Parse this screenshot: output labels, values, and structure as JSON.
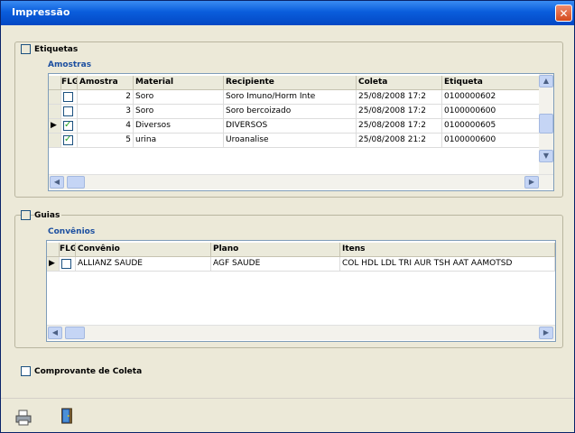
{
  "window": {
    "title": "Impressão",
    "close_label": "✕"
  },
  "etiquetas": {
    "label": "Etiquetas",
    "checked": false,
    "sublabel": "Amostras",
    "columns": [
      "FLG",
      "Amostra",
      "Material",
      "Recipiente",
      "Coleta",
      "Etiqueta"
    ],
    "rows": [
      {
        "current": false,
        "flg": false,
        "amostra": "2",
        "material": "Soro",
        "recipiente": "Soro Imuno/Horm Inte",
        "coleta": "25/08/2008 17:2",
        "etiqueta": "0100000602"
      },
      {
        "current": false,
        "flg": false,
        "amostra": "3",
        "material": "Soro",
        "recipiente": "Soro bercoizado",
        "coleta": "25/08/2008 17:2",
        "etiqueta": "0100000600"
      },
      {
        "current": true,
        "flg": true,
        "amostra": "4",
        "material": "Diversos",
        "recipiente": "DIVERSOS",
        "coleta": "25/08/2008 17:2",
        "etiqueta": "0100000605"
      },
      {
        "current": false,
        "flg": true,
        "amostra": "5",
        "material": "urina",
        "recipiente": "Uroanalise",
        "coleta": "25/08/2008 21:2",
        "etiqueta": "0100000600"
      }
    ]
  },
  "guias": {
    "label": "Guias",
    "checked": false,
    "sublabel": "Convênios",
    "columns": [
      "FLG",
      "Convênio",
      "Plano",
      "Itens"
    ],
    "rows": [
      {
        "current": true,
        "flg": false,
        "convenio": "ALLIANZ SAUDE",
        "plano": "AGF SAUDE",
        "itens": "COL HDL LDL TRI AUR TSH AAT AAMOTSD"
      }
    ]
  },
  "comprovante": {
    "label": "Comprovante de Coleta",
    "checked": false
  },
  "scroll_glyphs": {
    "left": "◀",
    "right": "▶",
    "up": "▲",
    "down": "▼"
  },
  "toolbar": {
    "icons": [
      "printer-icon",
      "exit-door-icon"
    ]
  }
}
